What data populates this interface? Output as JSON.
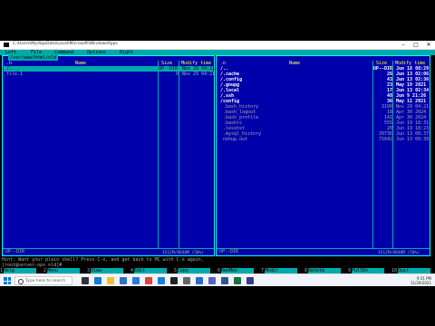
{
  "window": {
    "title": "C:\\Users\\My\\AppData\\Local\\Microsoft\\WindowsApps"
  },
  "menubar": {
    "items": [
      "Left",
      "File",
      "Command",
      "Options",
      "Right"
    ]
  },
  "left_panel": {
    "title": "/var/www/html/old",
    "headers": {
      "col_n": ".n",
      "name": "Name",
      "size": "Size",
      "mtime": "Modify time"
    },
    "rows": [
      {
        "name": "/..",
        "size": "UP--DIR",
        "mtime": "Nov 29 04:21",
        "selected": true,
        "kind": "dir"
      },
      {
        "name": "file.1",
        "size": "0",
        "mtime": "Nov 29 04:21",
        "selected": false,
        "kind": "file"
      }
    ],
    "footer": "UP--DIR",
    "free": "4512M/8848M (50%)"
  },
  "right_panel": {
    "title": "",
    "headers": {
      "col_n": ".n",
      "name": "Name",
      "size": "Size",
      "mtime": "Modify time"
    },
    "rows": [
      {
        "name": "/..",
        "size": "UP--DIR",
        "mtime": "Jun 18 08:29",
        "kind": "dir"
      },
      {
        "name": "/.cache",
        "size": "26",
        "mtime": "Jun 13 02:06",
        "kind": "dir"
      },
      {
        "name": "/.config",
        "size": "43",
        "mtime": "Jun 13 02:36",
        "kind": "dir"
      },
      {
        "name": "/.gnupg",
        "size": "23",
        "mtime": "May 19 2021",
        "kind": "dir"
      },
      {
        "name": "/.local",
        "size": "17",
        "mtime": "Jun 13 02:34",
        "kind": "dir"
      },
      {
        "name": "/.ssh",
        "size": "48",
        "mtime": "Jun 9 21:26",
        "kind": "dir"
      },
      {
        "name": "/config",
        "size": "36",
        "mtime": "May 11 2021",
        "kind": "dir"
      },
      {
        "name": " .bash_history",
        "size": "3190",
        "mtime": "Nov 29 04:21",
        "kind": "file"
      },
      {
        "name": " .bash_logout",
        "size": "18",
        "mtime": "Apr 30 2024",
        "kind": "file"
      },
      {
        "name": " .bash_profile",
        "size": "141",
        "mtime": "Apr 30 2024",
        "kind": "file"
      },
      {
        "name": " .bashrc",
        "size": "555",
        "mtime": "Jun 19 18:31",
        "kind": "file"
      },
      {
        "name": " .lesshst",
        "size": "20",
        "mtime": "Jun 19 18:23",
        "kind": "file"
      },
      {
        "name": " .mysql_history",
        "size": "39736",
        "mtime": "Jun 13 08:37",
        "kind": "file"
      },
      {
        "name": " nohup.out",
        "size": "71642",
        "mtime": "Jun 13 09:39",
        "kind": "file"
      }
    ],
    "footer": "UP--DIR",
    "free": "4512M/8848M (50%)"
  },
  "hint": "Hint: Want your plain shell? Press C-o, and get back to MC with C-o again.",
  "command_line": "[root@server-ops old]#",
  "fkeys": [
    {
      "n": "1",
      "label": "Help"
    },
    {
      "n": "2",
      "label": "Menu"
    },
    {
      "n": "3",
      "label": "View"
    },
    {
      "n": "4",
      "label": "Edit"
    },
    {
      "n": "5",
      "label": "Copy"
    },
    {
      "n": "6",
      "label": "RenMov"
    },
    {
      "n": "7",
      "label": "Mkdir"
    },
    {
      "n": "8",
      "label": "Delete"
    },
    {
      "n": "9",
      "label": "PullDn"
    },
    {
      "n": "10",
      "label": "Quit"
    }
  ],
  "taskbar": {
    "search_placeholder": "Type here to search",
    "time": "9:31 PM",
    "date": "11/29/2021",
    "icons": [
      "task-view-icon",
      "edge-icon",
      "file-explorer-icon",
      "store-icon",
      "mail-icon",
      "chrome-icon",
      "vscode-icon",
      "terminal-icon",
      "settings-icon",
      "photos-icon",
      "teams-icon",
      "word-icon",
      "excel-icon",
      "putty-icon"
    ],
    "icon_colors": [
      "#333333",
      "#0f7bd3",
      "#f2c02b",
      "#2b73c6",
      "#2a7cd8",
      "#e3403a",
      "#1a7fd4",
      "#222222",
      "#666666",
      "#2a6cc7",
      "#5b5fc7",
      "#2b5797",
      "#1e7145",
      "#3a3a8c"
    ]
  }
}
